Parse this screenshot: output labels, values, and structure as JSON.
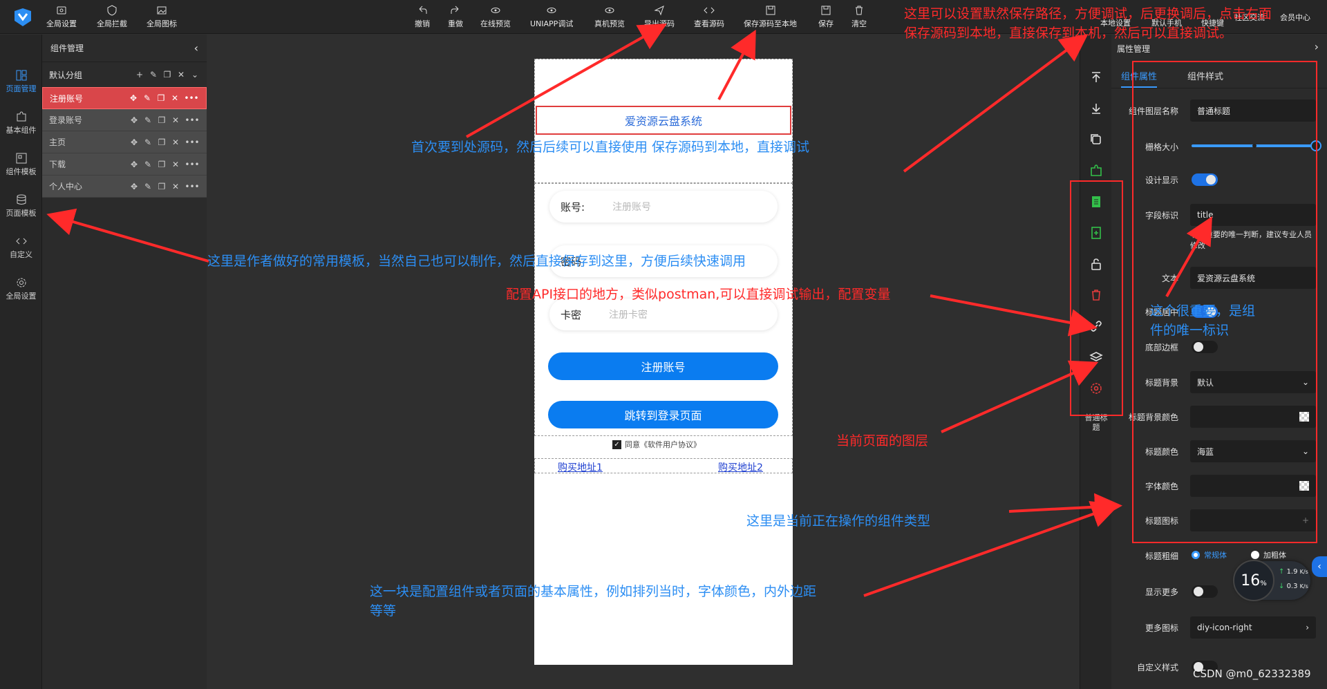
{
  "toolbar": {
    "left": [
      {
        "label": "全局设置",
        "icon": "settings-icon"
      },
      {
        "label": "全局拦截",
        "icon": "shield-icon"
      },
      {
        "label": "全局图标",
        "icon": "image-icon"
      }
    ],
    "center": [
      {
        "label": "撤销",
        "icon": "undo-icon"
      },
      {
        "label": "重做",
        "icon": "redo-icon"
      },
      {
        "label": "在线预览",
        "icon": "eye-icon"
      },
      {
        "label": "UNIAPP调试",
        "icon": "eye-icon"
      },
      {
        "label": "真机预览",
        "icon": "eye-icon"
      },
      {
        "label": "导出源码",
        "icon": "send-icon"
      },
      {
        "label": "查看源码",
        "icon": "code-icon"
      },
      {
        "label": "保存源码至本地",
        "icon": "save-icon"
      },
      {
        "label": "保存",
        "icon": "save-icon"
      },
      {
        "label": "清空",
        "icon": "trash-icon"
      }
    ],
    "right": [
      {
        "label": "本地设置"
      },
      {
        "label": "默认手机"
      },
      {
        "label": "快捷键"
      },
      {
        "label": "社区交流"
      },
      {
        "label": "会员中心"
      }
    ]
  },
  "rail": [
    {
      "label": "页面管理",
      "icon": "pages-icon",
      "active": true
    },
    {
      "label": "基本组件",
      "icon": "puzzle-icon"
    },
    {
      "label": "组件模板",
      "icon": "template-icon"
    },
    {
      "label": "页面模板",
      "icon": "database-icon"
    },
    {
      "label": "自定义",
      "icon": "code-icon"
    },
    {
      "label": "全局设置",
      "icon": "gear-icon"
    }
  ],
  "left_panel": {
    "title": "组件管理",
    "group": "默认分组",
    "pages": [
      {
        "label": "注册账号",
        "active": true
      },
      {
        "label": "登录账号"
      },
      {
        "label": "主页"
      },
      {
        "label": "下载"
      },
      {
        "label": "个人中心"
      }
    ]
  },
  "canvas": {
    "title": "爱资源云盘系统",
    "fields": [
      {
        "label": "账号:",
        "placeholder": "注册账号"
      },
      {
        "label": "密码",
        "placeholder": ""
      },
      {
        "label": "卡密",
        "placeholder": "注册卡密"
      }
    ],
    "primary_button": "注册账号",
    "secondary_button": "跳转到登录页面",
    "agreement": "同意《软件用户协议》",
    "link1": "购买地址1",
    "link2": "购买地址2"
  },
  "icon_column": {
    "bottom_label": "普通标题"
  },
  "property_panel": {
    "title": "属性管理",
    "tabs": [
      "组件属性",
      "组件样式"
    ],
    "layer_name_label": "组件图层名称",
    "layer_name_value": "普通标题",
    "grid_label": "栅格大小",
    "design_label": "设计显示",
    "field_label": "字段标识",
    "field_value": "title",
    "field_hint": "非常重要的唯一判断，建议专业人员修改",
    "text_label": "文本",
    "text_value": "爱资源云盘系统",
    "center_label": "标题居中",
    "border_label": "底部边框",
    "bg_label": "标题背景",
    "bg_value": "默认",
    "bgcolor_label": "标题背景颜色",
    "color_label": "标题颜色",
    "color_value": "海蓝",
    "font_color_label": "字体颜色",
    "icon_label": "标题图标",
    "weight_label": "标题粗细",
    "weight_opt1": "常规体",
    "weight_opt2": "加粗体",
    "more_label": "显示更多",
    "more_icon_label": "更多图标",
    "more_icon_value": "diy-icon-right",
    "custom_style_label": "自定义样式"
  },
  "speed_widget": {
    "percent": "16",
    "unit": "%",
    "up": "1.9",
    "down": "0.3",
    "rate_unit": "K/s"
  },
  "annotations": {
    "top_right_1": "这里可以设置默然保存路径，方便调试，后更换调后，点击右面",
    "top_right_2": "保存源码到本地，直接保存到本机，然后可以直接调试。",
    "source": "首次要到处源码，然后后续可以直接使用 保存源码到本地，直接调试",
    "template": "这里是作者做好的常用模板，当然自己也可以制作，然后直接保存到这里，方便后续快速调用",
    "api": "配置API接口的地方，类似postman,可以直接调试输出，配置变量",
    "unique_1": "这个很重要，是组",
    "unique_2": "件的唯一标识",
    "layers": "当前页面的图层",
    "component_type": "这里是当前正在操作的组件类型",
    "basic_1": "这一块是配置组件或者页面的基本属性，例如排列当时，字体颜色，内外边距",
    "basic_2": "等等"
  },
  "watermark": "CSDN @m0_62332389",
  "colors": {
    "accent": "#3a9bff",
    "annotation_red": "#ff2a2a",
    "annotation_blue": "#2c8ef3",
    "button_blue": "#0a7cf0",
    "active_row": "#d9464a"
  }
}
